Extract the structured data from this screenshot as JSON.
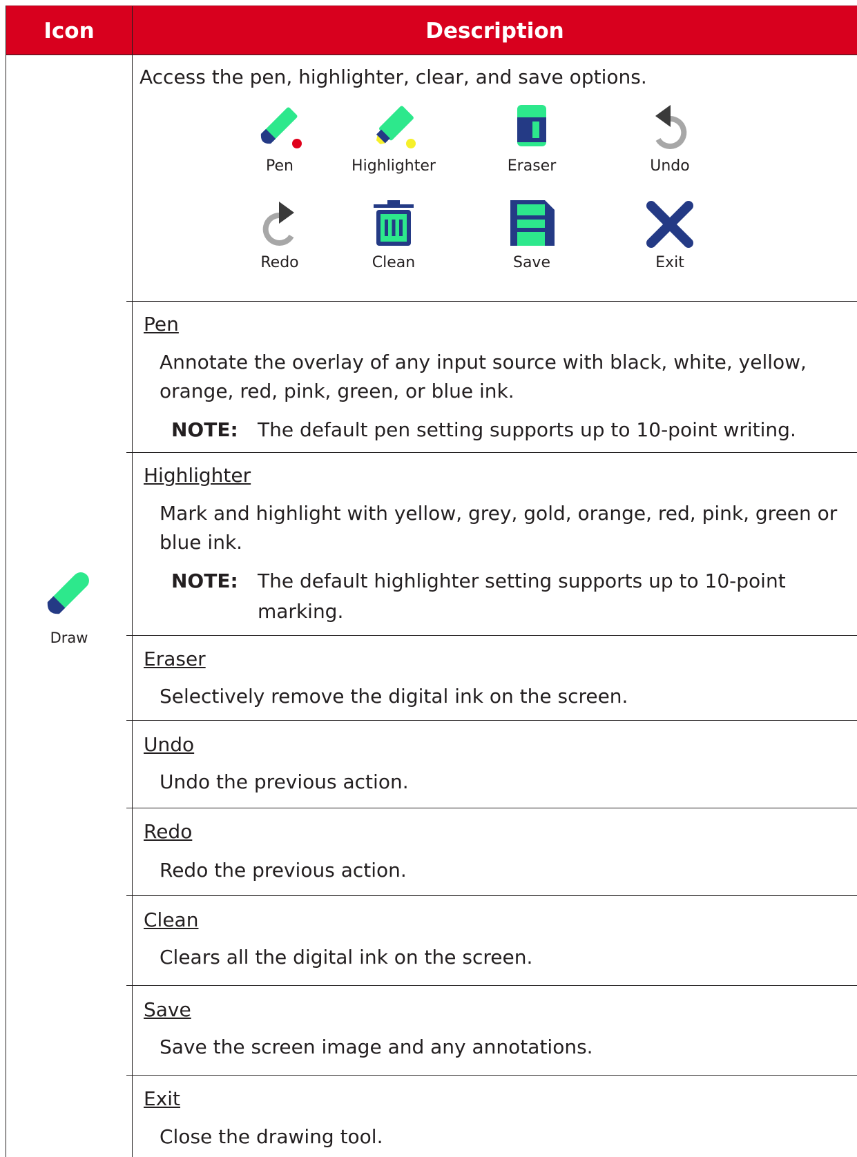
{
  "header": {
    "icon_col": "Icon",
    "desc_col": "Description"
  },
  "draw": {
    "label": "Draw",
    "icon": "pen-icon"
  },
  "intro": "Access the pen, highlighter, clear, and save options.",
  "tools": [
    {
      "label": "Pen",
      "icon": "pen-icon"
    },
    {
      "label": "Highlighter",
      "icon": "highlighter-icon"
    },
    {
      "label": "Eraser",
      "icon": "eraser-icon"
    },
    {
      "label": "Undo",
      "icon": "undo-icon"
    },
    {
      "label": "Redo",
      "icon": "redo-icon"
    },
    {
      "label": "Clean",
      "icon": "trash-icon"
    },
    {
      "label": "Save",
      "icon": "save-icon"
    },
    {
      "label": "Exit",
      "icon": "close-icon"
    }
  ],
  "sections": {
    "pen": {
      "title": "Pen",
      "text": "Annotate the overlay of any input source with black, white, yellow, orange, red, pink, green, or blue ink.",
      "note_label": "NOTE:",
      "note_text": "The default pen setting supports up to 10-point writing."
    },
    "highlighter": {
      "title": "Highlighter",
      "text": "Mark and highlight with yellow, grey, gold, orange, red, pink, green or blue ink.",
      "note_label": "NOTE:",
      "note_text": "The default highlighter setting supports up to 10-point marking."
    },
    "eraser": {
      "title": "Eraser",
      "text": "Selectively remove the digital ink on the screen."
    },
    "undo": {
      "title": "Undo",
      "text": "Undo the previous action."
    },
    "redo": {
      "title": "Redo",
      "text": "Redo the previous action."
    },
    "clean": {
      "title": "Clean",
      "text": "Clears all the digital ink on the screen."
    },
    "save": {
      "title": "Save",
      "text": "Save the screen image and any annotations."
    },
    "exit": {
      "title": "Exit",
      "text": "Close the drawing tool."
    }
  },
  "colors": {
    "header_red": "#d8001e",
    "icon_green": "#2de88c",
    "icon_navy": "#243a85",
    "icon_grey": "#a7a7a7",
    "icon_dark": "#3a3a3a",
    "dot_red": "#e0001b",
    "dot_yellow": "#f6f02a"
  }
}
